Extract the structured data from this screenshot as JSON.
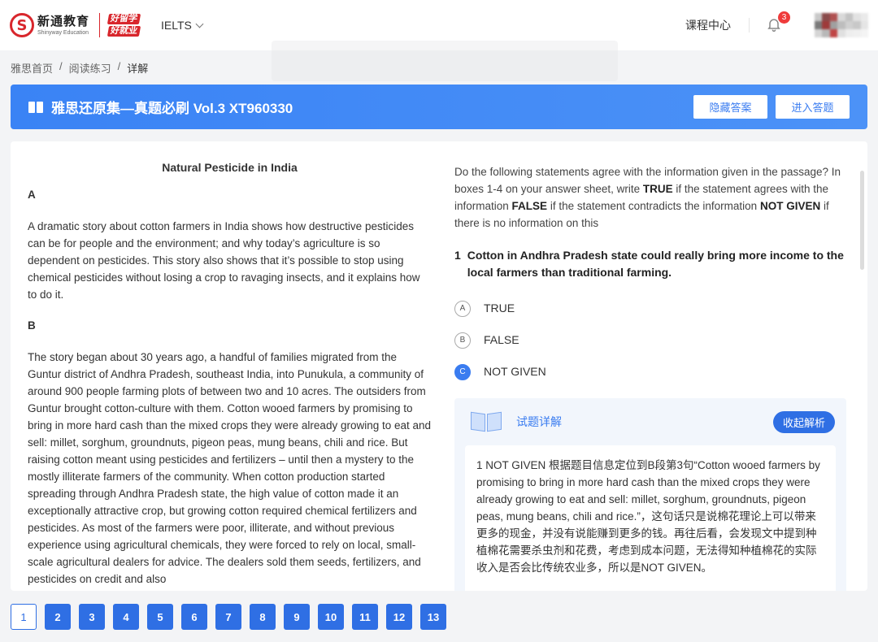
{
  "header": {
    "logo_mark": "S",
    "logo_cn": "新通教育",
    "logo_en": "Shinyway Education",
    "slogan": [
      "好留学",
      "好就业"
    ],
    "exam_select": "IELTS",
    "course_center": "课程中心",
    "notification_count": "3"
  },
  "breadcrumb": {
    "items": [
      "雅思首页",
      "阅读练习",
      "详解"
    ],
    "separator": "/"
  },
  "titlebar": {
    "title": "雅思还原集—真题必刷 Vol.3 XT960330",
    "hide_answer": "隐藏答案",
    "enter_answer": "进入答题"
  },
  "passage": {
    "heading": "Natural Pesticide in India",
    "sections": [
      {
        "label": "A",
        "text": "A dramatic story about cotton farmers in India shows how destructive pesticides can be for people and the environment; and why today’s agriculture is so dependent on pesticides. This story also shows that it’s possible to stop using chemical pesticides without losing a crop to ravaging insects, and it explains how to do it."
      },
      {
        "label": "B",
        "text": "The story began about 30 years ago, a handful of families migrated from the Guntur district of Andhra Pradesh, southeast India, into Punukula, a community of around 900 people farming plots of between two and 10 acres. The outsiders from Guntur brought cotton-culture with them. Cotton wooed farmers by promising to bring in more hard cash than the mixed crops they were already growing to eat and sell: millet, sorghum, groundnuts, pigeon peas, mung beans, chili and rice. But raising cotton meant using pesticides and fertilizers – until then a mystery to the mostly illiterate farmers of the community. When cotton production started spreading through Andhra Pradesh state, the high value of cotton made it an exceptionally attractive crop, but growing cotton required chemical fertilizers and pesticides. As most of the farmers were poor, illiterate, and without previous experience using agricultural chemicals, they were forced to rely on local, small-scale agricultural dealers for advice. The dealers sold them seeds, fertilizers, and pesticides on credit and also"
      }
    ]
  },
  "question_panel": {
    "instruction_parts": [
      "Do the following statements agree with the information given in the passage? In boxes 1-4 on your answer sheet, write ",
      "TRUE",
      " if the statement agrees with the information ",
      "FALSE",
      " if the statement contradicts the information ",
      "NOT GIVEN",
      " if there is no information on this"
    ],
    "question_number": "1",
    "question_text": "Cotton in Andhra Pradesh state could really bring more income to the local farmers than traditional farming.",
    "options": [
      {
        "letter": "A",
        "label": "TRUE",
        "selected": false
      },
      {
        "letter": "B",
        "label": "FALSE",
        "selected": false
      },
      {
        "letter": "C",
        "label": "NOT GIVEN",
        "selected": true
      }
    ]
  },
  "explanation": {
    "title": "试题详解",
    "collapse": "收起解析",
    "text": "1 NOT GIVEN 根据题目信息定位到B段第3句“Cotton wooed farmers by promising to bring in more hard cash than the mixed crops they were already growing to eat and sell: millet, sorghum, groundnuts, pigeon peas, mung beans, chili and rice.”，这句话只是说棉花理论上可以带来更多的现金，并没有说能赚到更多的钱。再往后看，会发现文中提到种植棉花需要杀虫剂和花费，考虑到成本问题，无法得知种植棉花的实际收入是否会比传统农业多，所以是NOT GIVEN。"
  },
  "pagination": {
    "pages": [
      "1",
      "2",
      "3",
      "4",
      "5",
      "6",
      "7",
      "8",
      "9",
      "10",
      "11",
      "12",
      "13"
    ],
    "current": "1"
  },
  "colors": {
    "brand_red": "#d8262c",
    "primary_blue": "#2f6fe4",
    "title_blue": "#3a83f5",
    "badge_red": "#ef3b3b"
  },
  "icons": [
    "logo-mark-icon",
    "chevron-down-icon",
    "bell-icon",
    "book-icon",
    "open-book-icon"
  ]
}
